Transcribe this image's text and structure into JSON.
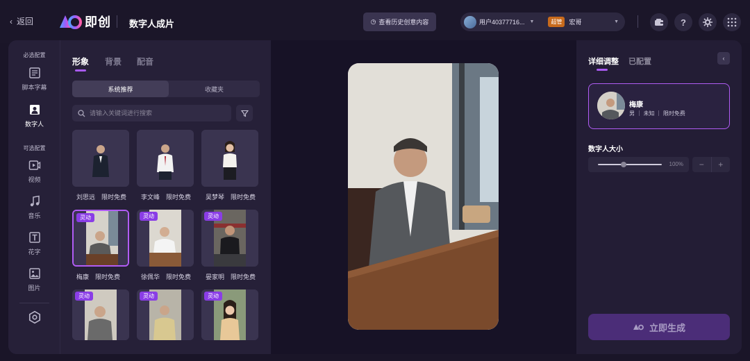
{
  "topbar": {
    "back_label": "返回",
    "logo_text": "即创",
    "page_title": "数字人成片",
    "history_button": "查看历史创意内容",
    "user_name": "用户40377716...",
    "admin_badge": "超管",
    "account_name": "宏哥"
  },
  "nav": {
    "required_section": "必选配置",
    "optional_section": "可选配置",
    "items": [
      {
        "label": "脚本字幕",
        "icon": "script-icon"
      },
      {
        "label": "数字人",
        "icon": "person-icon"
      },
      {
        "label": "视频",
        "icon": "video-icon"
      },
      {
        "label": "音乐",
        "icon": "music-icon"
      },
      {
        "label": "花字",
        "icon": "text-icon"
      },
      {
        "label": "图片",
        "icon": "image-icon"
      }
    ]
  },
  "panel": {
    "tabs": [
      "形象",
      "背景",
      "配音"
    ],
    "segment": [
      "系统推荐",
      "收藏夹"
    ],
    "search_placeholder": "请输入关键词进行搜索",
    "tag_label": "灵动",
    "cards": [
      {
        "name": "刘思远",
        "free": "限时免费"
      },
      {
        "name": "李文峰",
        "free": "限时免费"
      },
      {
        "name": "吴梦琴",
        "free": "限时免费"
      },
      {
        "name": "梅康",
        "free": "限时免费"
      },
      {
        "name": "徐佩华",
        "free": "限时免费"
      },
      {
        "name": "晏家明",
        "free": "限时免费"
      }
    ]
  },
  "right": {
    "tabs": [
      "详细调整",
      "已配置"
    ],
    "person": {
      "name": "梅康",
      "meta": "男 ｜ 未知 ｜ 限时免费"
    },
    "size_title": "数字人大小",
    "size_value": "100%",
    "size_level": 0.4,
    "generate_label": "立即生成"
  },
  "colors": {
    "accent": "#b15cf5",
    "admin_badge": "#c76a1c"
  }
}
